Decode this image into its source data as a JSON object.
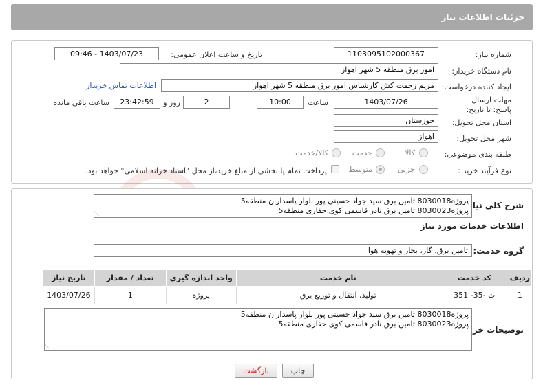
{
  "header": {
    "title": "جزئیات اطلاعات نیاز"
  },
  "form": {
    "need_number": {
      "label": "شماره نیاز:",
      "value": "1103095102000367"
    },
    "announce": {
      "label": "تاریخ و ساعت اعلان عمومی:",
      "value": "1403/07/23 - 09:46"
    },
    "buyer_org": {
      "label": "نام دستگاه خریدار:",
      "value": "امور برق منطقه 5 شهر اهواز"
    },
    "creator": {
      "label": "ایجاد کننده درخواست:",
      "value": "مریم زحمت کش کارشناس امور برق منطقه 5 شهر اهواز",
      "contact_link": "اطلاعات تماس خریدار"
    },
    "deadline": {
      "label": "مهلت ارسال پاسخ: تا تاریخ:",
      "date": "1403/07/26",
      "time_label": "ساعت",
      "time": "10:00",
      "days": "2",
      "days_label": "روز و",
      "remaining": "23:42:59",
      "remaining_label": "ساعت باقی مانده"
    },
    "province": {
      "label": "استان محل تحویل:",
      "value": "خوزستان"
    },
    "city": {
      "label": "شهر محل تحویل:",
      "value": "اهواز"
    },
    "category": {
      "label": "طبقه بندی موضوعی:",
      "options": [
        "کالا",
        "خدمت",
        "کالا/خدمت"
      ]
    },
    "process": {
      "label": "نوع فرآیند خرید :",
      "options": [
        "جزیی",
        "متوسط"
      ],
      "payment_note": "پرداخت تمام یا بخشی از مبلغ خرید،از محل \"اسناد خزانه اسلامی\" خواهد بود."
    }
  },
  "summary": {
    "label": "شرح کلی نیاز:",
    "lines": [
      "پروژه8030018 تامین برق سید جواد حسینی پور بلوار پاسداران منطقه5",
      "پروژه8030023 تامین برق نادر قاسمی کوی حفاری منطقه5"
    ]
  },
  "services": {
    "section_title": "اطلاعات خدمات مورد نیاز",
    "group_label": "گروه خدمت:",
    "group_value": "تامین برق، گاز، بخار و تهویه هوا",
    "table": {
      "headers": [
        "ردیف",
        "کد خدمت",
        "نام خدمت",
        "واحد اندازه گیری",
        "تعداد / مقدار",
        "تاریخ نیاز"
      ],
      "rows": [
        [
          "1",
          "ت -35- 351",
          "تولید، انتقال و توزیع برق",
          "پروژه",
          "1",
          "1403/07/26"
        ]
      ]
    }
  },
  "buyer_notes": {
    "label": "توضیحات خریدار:",
    "lines": [
      "پروژه8030018 تامین برق سید جواد حسینی پور بلوار پاسداران منطقه5",
      "پروژه8030023 تامین برق نادر قاسمی کوی حفاری منطقه5"
    ]
  },
  "buttons": {
    "print": "چاپ",
    "back": "بازگشت"
  },
  "colors": {
    "header_bg": "#a8a8a8",
    "link": "#2255cc",
    "back_text": "#cc2222",
    "table_header": "#d4d4d4"
  }
}
